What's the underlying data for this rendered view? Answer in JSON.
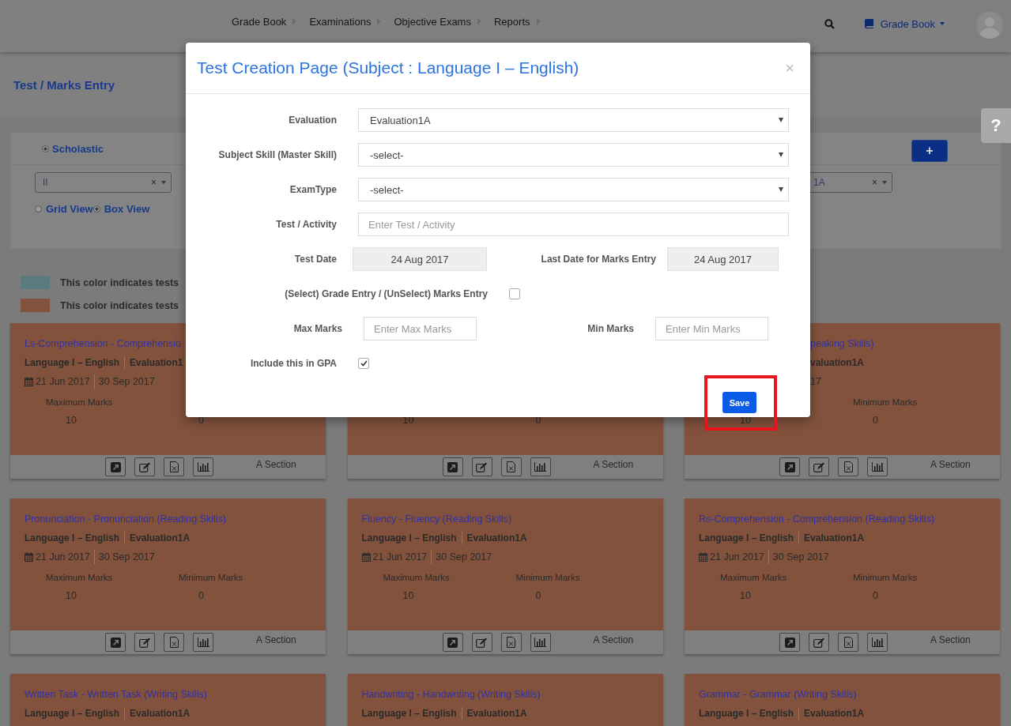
{
  "nav": {
    "items": [
      "Grade Book",
      "Examinations",
      "Objective Exams",
      "Reports"
    ],
    "module": "Grade Book"
  },
  "help_label": "?",
  "page_title": "Test / Marks Entry",
  "filters": {
    "category": {
      "label": "Scholastic",
      "selected": true
    },
    "class_select": "II",
    "clear_label": "×",
    "add_label": "+",
    "views": [
      {
        "label": "Grid View",
        "selected": false
      },
      {
        "label": "Box View",
        "selected": true
      }
    ],
    "section_select": "1A"
  },
  "legend": [
    {
      "color": "#5b7a80",
      "text": "This color indicates tests"
    },
    {
      "color": "#82523d",
      "text": "This color indicates tests"
    }
  ],
  "cards": [
    {
      "kind": "cut_right",
      "title": "Ls-Comprehension - Comprehensio",
      "subject": "Language I – English",
      "evaluation": "Evaluation1",
      "start_date": "21 Jun 2017",
      "end_date": "30 Sep 2017",
      "max_label": "Maximum Marks",
      "max_value": "10",
      "min_value": "0",
      "section": "A Section"
    },
    {
      "kind": "covered",
      "max_value": "10",
      "min_value": "0",
      "section": "A Section"
    },
    {
      "kind": "cut_left",
      "title": "peaking Skills)",
      "evaluation": "valuation1A",
      "end_date": "17",
      "min_label": "Minimum Marks",
      "max_value": "10",
      "min_value": "0",
      "section": "A Section"
    },
    {
      "kind": "full",
      "title": "Pronunciation - Pronunciation (Reading Skills)",
      "subject": "Language I – English",
      "evaluation": "Evaluation1A",
      "start_date": "21 Jun 2017",
      "end_date": "30 Sep 2017",
      "max_label": "Maximum Marks",
      "max_value": "10",
      "min_label": "Minimum Marks",
      "min_value": "0",
      "section": "A Section"
    },
    {
      "kind": "full",
      "title": "Fluency - Fluency (Reading Skills)",
      "subject": "Language I – English",
      "evaluation": "Evaluation1A",
      "start_date": "21 Jun 2017",
      "end_date": "30 Sep 2017",
      "max_label": "Maximum Marks",
      "max_value": "10",
      "min_label": "Minimum Marks",
      "min_value": "0",
      "section": "A Section"
    },
    {
      "kind": "full",
      "title": "Rs-Comprehension - Comprehension (Reading Skills)",
      "subject": "Language I – English",
      "evaluation": "Evaluation1A",
      "start_date": "21 Jun 2017",
      "end_date": "30 Sep 2017",
      "max_label": "Maximum Marks",
      "max_value": "10",
      "min_label": "Minimum Marks",
      "min_value": "0",
      "section": "A Section"
    },
    {
      "kind": "clipped",
      "title": "Written Task - Written Task (Writing Skills)",
      "subject": "Language I – English",
      "evaluation": "Evaluation1A"
    },
    {
      "kind": "clipped",
      "title": "Handwriting - Handwriting (Writing Skills)",
      "subject": "Language I – English",
      "evaluation": "Evaluation1A"
    },
    {
      "kind": "clipped",
      "title": "Grammar - Grammar (Writing Skills)",
      "subject": "Language I – English",
      "evaluation": "Evaluation1A"
    }
  ],
  "modal": {
    "title": "Test Creation Page (Subject : Language I – English)",
    "close": "×",
    "rows": [
      {
        "kind": "select",
        "label": "Evaluation",
        "value": "Evaluation1A"
      },
      {
        "kind": "select",
        "label": "Subject Skill (Master Skill)",
        "value": "-select-"
      },
      {
        "kind": "select",
        "label": "ExamType",
        "value": "-select-"
      },
      {
        "kind": "text",
        "label": "Test / Activity",
        "placeholder": "Enter Test / Activity"
      }
    ],
    "test_date": {
      "label": "Test Date",
      "value": "24 Aug 2017"
    },
    "last_date": {
      "label": "Last Date for Marks Entry",
      "value": "24 Aug 2017"
    },
    "grade_entry": {
      "label": "(Select) Grade Entry / (UnSelect) Marks Entry",
      "checked": false
    },
    "max_marks": {
      "label": "Max Marks",
      "placeholder": "Enter Max Marks"
    },
    "min_marks": {
      "label": "Min Marks",
      "placeholder": "Enter Min Marks"
    },
    "gpa": {
      "label": "Include this in GPA",
      "checked": true
    },
    "save": {
      "label": "Save",
      "highlighted": true
    }
  }
}
